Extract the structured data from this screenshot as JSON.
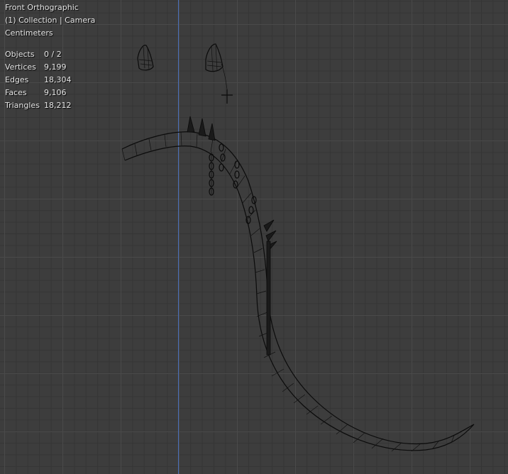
{
  "viewport": {
    "view_name": "Front Orthographic",
    "collection_camera": "(1) Collection | Camera",
    "units": "Centimeters"
  },
  "stats": [
    {
      "label": "Objects",
      "value": "0 / 2"
    },
    {
      "label": "Vertices",
      "value": "9,199"
    },
    {
      "label": "Edges",
      "value": "18,304"
    },
    {
      "label": "Faces",
      "value": "9,106"
    },
    {
      "label": "Triangles",
      "value": "18,212"
    }
  ],
  "colors": {
    "background": "#3d3d3d",
    "grid_major": "#4a4a4a",
    "grid_minor": "#353535",
    "z_axis": "#4a6fb8",
    "wireframe": "#0b0b0b",
    "overlay_text": "#e6e6e6"
  }
}
